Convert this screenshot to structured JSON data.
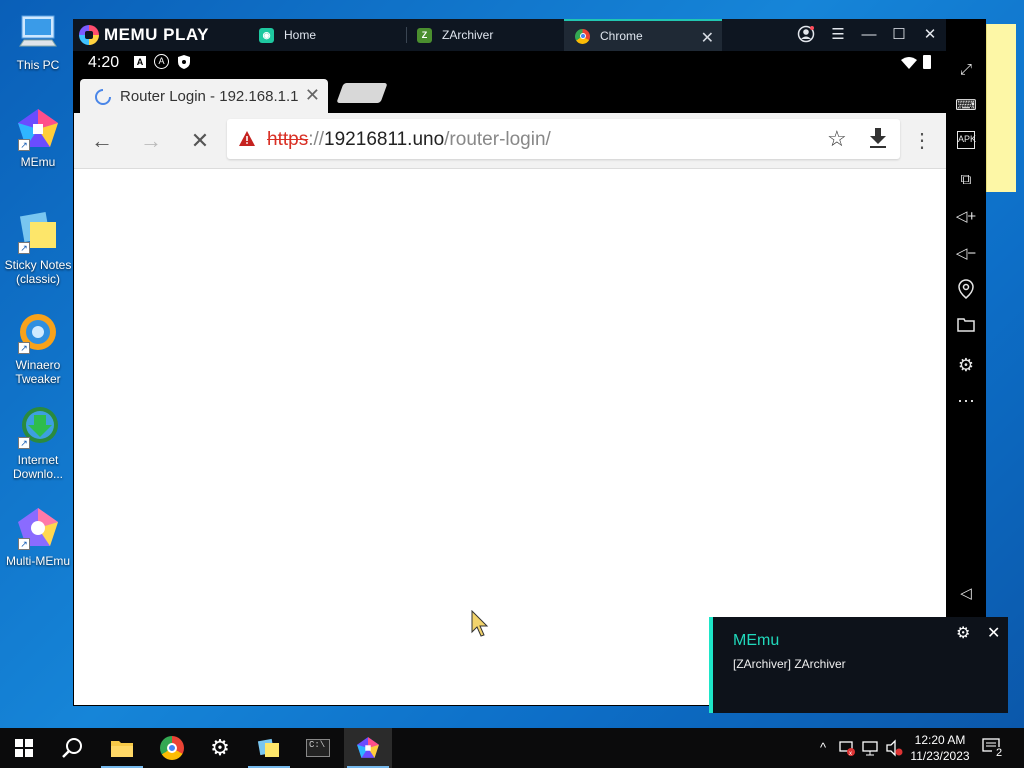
{
  "desktop": {
    "icons": [
      {
        "label": "This PC",
        "icon": "computer-icon"
      },
      {
        "label": "MEmu",
        "icon": "memu-icon"
      },
      {
        "label": "Sticky Notes (classic)",
        "icon": "sticky-notes-icon"
      },
      {
        "label": "Winaero Tweaker",
        "icon": "winaero-icon"
      },
      {
        "label": "Internet Downlo...",
        "icon": "idm-icon"
      },
      {
        "label": "Multi-MEmu",
        "icon": "multi-memu-icon"
      }
    ]
  },
  "memu": {
    "logo": "MEMU PLAY",
    "tabs": [
      {
        "label": "Home",
        "icon": "home-app-icon",
        "color": "#1ec8a0"
      },
      {
        "label": "ZArchiver",
        "icon": "zarchiver-icon",
        "color": "#4b8f2f"
      },
      {
        "label": "Chrome",
        "icon": "chrome-icon",
        "color": "#4285f4"
      }
    ],
    "controls": [
      "account-icon",
      "menu-icon",
      "minimize-icon",
      "maximize-icon",
      "close-icon",
      "collapse-icon"
    ],
    "sidebar": [
      "fullscreen-icon",
      "keyboard-icon",
      "apk-icon",
      "multi-window-icon",
      "volume-up-icon",
      "volume-down-icon",
      "location-icon",
      "folder-icon",
      "settings-icon",
      "more-icon",
      "back-icon"
    ]
  },
  "android": {
    "status_time": "4:20",
    "status_icons": [
      "a-icon",
      "autorotate-icon",
      "shield-icon"
    ],
    "right_icons": [
      "wifi-icon",
      "battery-icon"
    ]
  },
  "chrome": {
    "tab_title": "Router Login - 192.168.1.1",
    "url_scheme": "https",
    "url_sep": "://",
    "url_host": "19216811.uno",
    "url_path": "/router-login/"
  },
  "notification": {
    "title": "MEmu",
    "body": "[ZArchiver] ZArchiver"
  },
  "taskbar": {
    "time": "12:20 AM",
    "date": "11/23/2023",
    "notif_count": "2"
  }
}
